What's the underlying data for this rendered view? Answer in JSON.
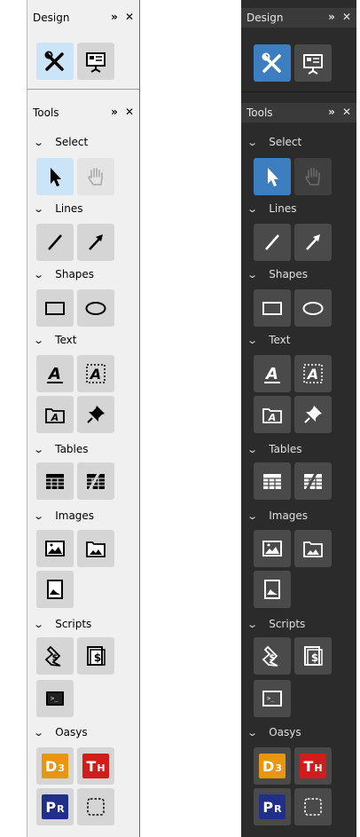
{
  "design_panel": {
    "title": "Design",
    "pin_glyph": "⏩",
    "close_glyph": "✕",
    "buttons": [
      {
        "icon": "tools-icon"
      },
      {
        "icon": "presentation-icon"
      }
    ]
  },
  "tools_panel": {
    "title": "Tools",
    "pin_glyph": "⏩",
    "close_glyph": "✕"
  },
  "sections": [
    {
      "label": "Select"
    },
    {
      "label": "Lines"
    },
    {
      "label": "Shapes"
    },
    {
      "label": "Text"
    },
    {
      "label": "Tables"
    },
    {
      "label": "Images"
    },
    {
      "label": "Scripts"
    },
    {
      "label": "Oasys"
    }
  ],
  "oasys_badges": {
    "d3": {
      "main": "D",
      "sub": "3",
      "color": "#e8960c"
    },
    "th": {
      "main": "T",
      "sub": "H",
      "color": "#d31b1b"
    },
    "pr": {
      "main": "P",
      "sub": "R",
      "color": "#1f2f8a"
    }
  },
  "colors": {
    "light_selected": "#cce4f7",
    "dark_selected": "#3d7ec1",
    "dark_bg": "#2b2b2b",
    "light_bg": "#f0f0f0"
  }
}
